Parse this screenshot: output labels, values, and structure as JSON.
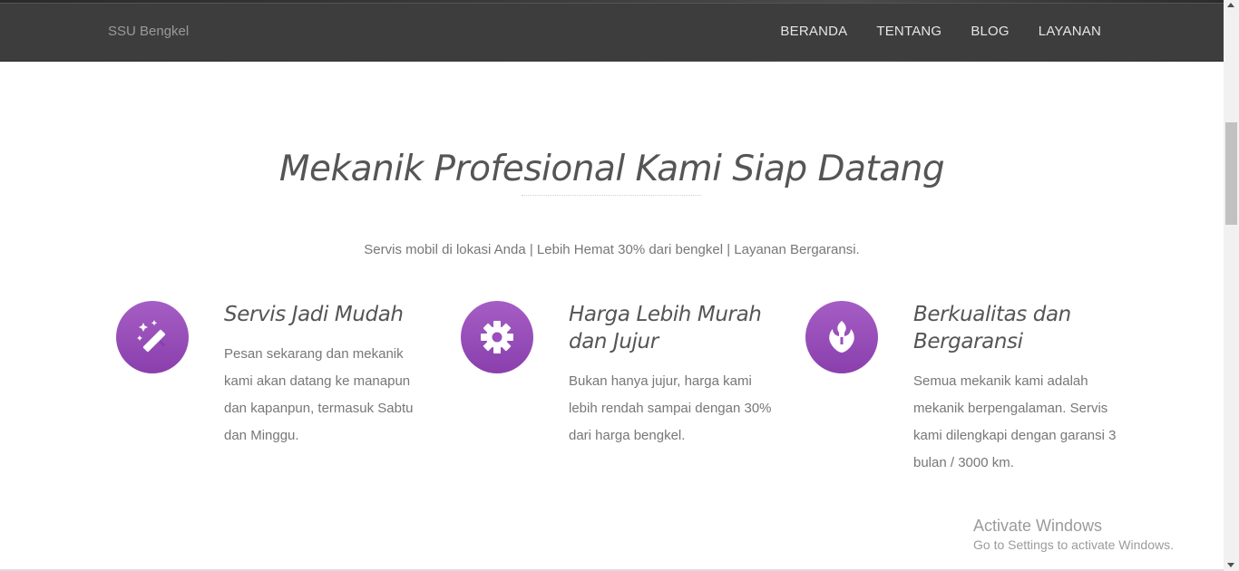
{
  "brand": "SSU Bengkel",
  "nav": [
    "BERANDA",
    "TENTANG",
    "BLOG",
    "LAYANAN"
  ],
  "section": {
    "title": "Mekanik Profesional Kami Siap Datang",
    "subtitle": "Servis mobil di lokasi Anda | Lebih Hemat 30% dari bengkel | Layanan Bergaransi."
  },
  "features": [
    {
      "icon": "magic-wand-icon",
      "title": "Servis Jadi Mudah",
      "description": "Pesan sekarang dan mekanik kami akan datang ke manapun dan kapanpun, termasuk Sabtu dan Minggu."
    },
    {
      "icon": "gear-icon",
      "title": "Harga Lebih Murah dan Jujur",
      "description": "Bukan hanya jujur, harga kami lebih rendah sampai dengan 30% dari harga bengkel."
    },
    {
      "icon": "rebel-alliance-icon",
      "title": "Berkualitas dan Bergaransi",
      "description": "Semua mekanik kami adalah mekanik berpengalaman. Servis kami dilengkapi dengan garansi 3 bulan / 3000 km."
    }
  ],
  "watermark": {
    "title": "Activate Windows",
    "subtitle": "Go to Settings to activate Windows."
  },
  "colors": {
    "accent": "#9b4fbd",
    "navbar": "#3d3d3d"
  }
}
